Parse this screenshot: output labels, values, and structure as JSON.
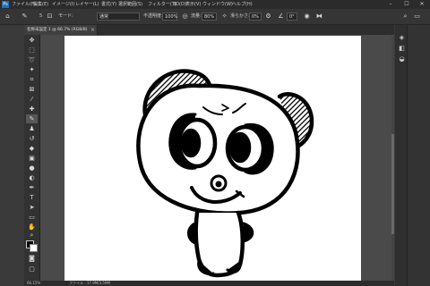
{
  "app": {
    "logo": "Ps"
  },
  "menu": [
    "ファイル(F)",
    "編集(E)",
    "イメージ(I)",
    "レイヤー(L)",
    "書式(Y)",
    "選択範囲(S)",
    "フィルター(T)",
    "3D(D)",
    "表示(V)",
    "ウィンドウ(W)",
    "ヘルプ(H)"
  ],
  "window_controls": {
    "minimize": "–",
    "maximize": "☐",
    "close": "✕"
  },
  "options": {
    "home_icon": "home-icon",
    "brush_size": "5",
    "mode_label": "モード:",
    "mode_value": "通常",
    "opacity_label": "不透明度:",
    "opacity_value": "100%",
    "flow_label": "流量:",
    "flow_value": "80%",
    "smoothing_label": "滑らかさ:",
    "smoothing_value": "0%",
    "angle_value": "0°"
  },
  "document": {
    "tab_title": "名称未設定 1 @ 66.7% (RGB/8)",
    "close": "×"
  },
  "status": {
    "zoom": "66.15%",
    "doc_info": "ファイル : 17.9M/3.59M"
  },
  "colors": {
    "accent": "#1f6fb6",
    "foreground": "#000000",
    "background": "#ffffff"
  }
}
